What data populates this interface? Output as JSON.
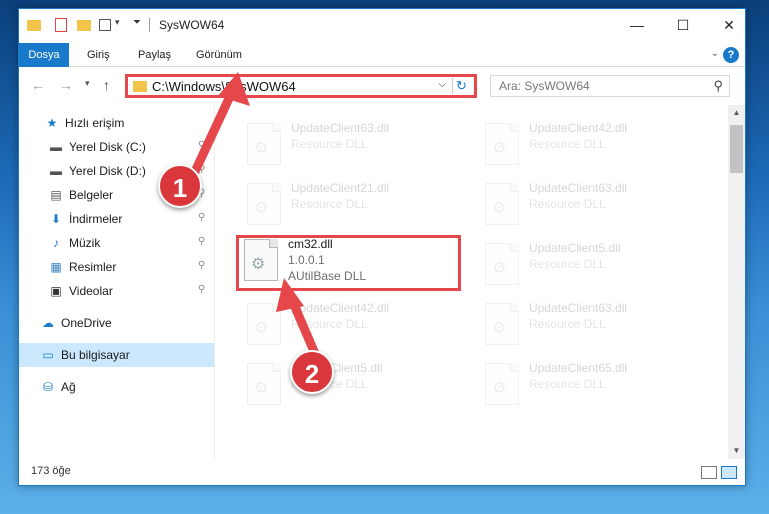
{
  "window": {
    "title": "SysWOW64",
    "minimize": "—",
    "maximize": "☐",
    "close": "✕"
  },
  "ribbon": {
    "tabs": [
      "Dosya",
      "Giriş",
      "Paylaş",
      "Görünüm"
    ],
    "collapse_icon": "⌄",
    "help_label": "?"
  },
  "nav": {
    "back": "←",
    "forward": "→",
    "recent": "▾",
    "up": "↑"
  },
  "address": {
    "path": "C:\\Windows\\SysWOW64",
    "dropdown": "⌵",
    "refresh": "↻"
  },
  "search": {
    "placeholder": "Ara: SysWOW64",
    "icon": "⚲"
  },
  "sidebar": {
    "items": [
      {
        "label": "Hızlı erişim",
        "icon": "★",
        "icon_color": "#1979ca",
        "pinned": false
      },
      {
        "label": "Yerel Disk (C:)",
        "icon": "▬",
        "icon_color": "#555555",
        "pinned": true
      },
      {
        "label": "Yerel Disk (D:)",
        "icon": "▬",
        "icon_color": "#555555",
        "pinned": true
      },
      {
        "label": "Belgeler",
        "icon": "▤",
        "icon_color": "#555555",
        "pinned": true
      },
      {
        "label": "İndirmeler",
        "icon": "⬇",
        "icon_color": "#1979ca",
        "pinned": true
      },
      {
        "label": "Müzik",
        "icon": "♪",
        "icon_color": "#1979ca",
        "pinned": true
      },
      {
        "label": "Resimler",
        "icon": "▦",
        "icon_color": "#3a7fc1",
        "pinned": true
      },
      {
        "label": "Videolar",
        "icon": "▣",
        "icon_color": "#333333",
        "pinned": true
      },
      {
        "label": "OneDrive",
        "icon": "☁",
        "icon_color": "#1979ca",
        "pinned": false
      },
      {
        "label": "Bu bilgisayar",
        "icon": "▭",
        "icon_color": "#1979ca",
        "pinned": false,
        "selected": true
      },
      {
        "label": "Ağ",
        "icon": "⛁",
        "icon_color": "#1979ca",
        "pinned": false
      }
    ],
    "pin_icon": "📌"
  },
  "files": [
    {
      "name": "UpdateClient63.dll",
      "line2": "Resource DLL",
      "line3": "",
      "col": 0,
      "row": 0,
      "faded": true
    },
    {
      "name": "UpdateClient42.dll",
      "line2": "Resource DLL",
      "line3": "",
      "col": 1,
      "row": 0,
      "faded": true
    },
    {
      "name": "UpdateClient21.dll",
      "line2": "Resource DLL",
      "line3": "",
      "col": 0,
      "row": 1,
      "faded": true
    },
    {
      "name": "UpdateClient63.dll",
      "line2": "Resource DLL",
      "line3": "",
      "col": 1,
      "row": 1,
      "faded": true
    },
    {
      "name": "cm32.dll",
      "line2": "1.0.0.1",
      "line3": "AUtilBase DLL",
      "col": 0,
      "row": 2,
      "faded": false,
      "highlighted": true
    },
    {
      "name": "UpdateClient5.dll",
      "line2": "Resource DLL",
      "line3": "",
      "col": 1,
      "row": 2,
      "faded": true
    },
    {
      "name": "UpdateClient42.dll",
      "line2": "Resource DLL",
      "line3": "",
      "col": 0,
      "row": 3,
      "faded": true
    },
    {
      "name": "UpdateClient63.dll",
      "line2": "Resource DLL",
      "line3": "",
      "col": 1,
      "row": 3,
      "faded": true
    },
    {
      "name": "UpdateClient5.dll",
      "line2": "Resource DLL",
      "line3": "",
      "col": 0,
      "row": 4,
      "faded": true
    },
    {
      "name": "UpdateClient65.dll",
      "line2": "Resource DLL",
      "line3": "",
      "col": 1,
      "row": 4,
      "faded": true
    }
  ],
  "status": {
    "count": "173 öğe"
  },
  "annotations": {
    "badge1": "1",
    "badge2": "2",
    "color": "#e5474b"
  }
}
